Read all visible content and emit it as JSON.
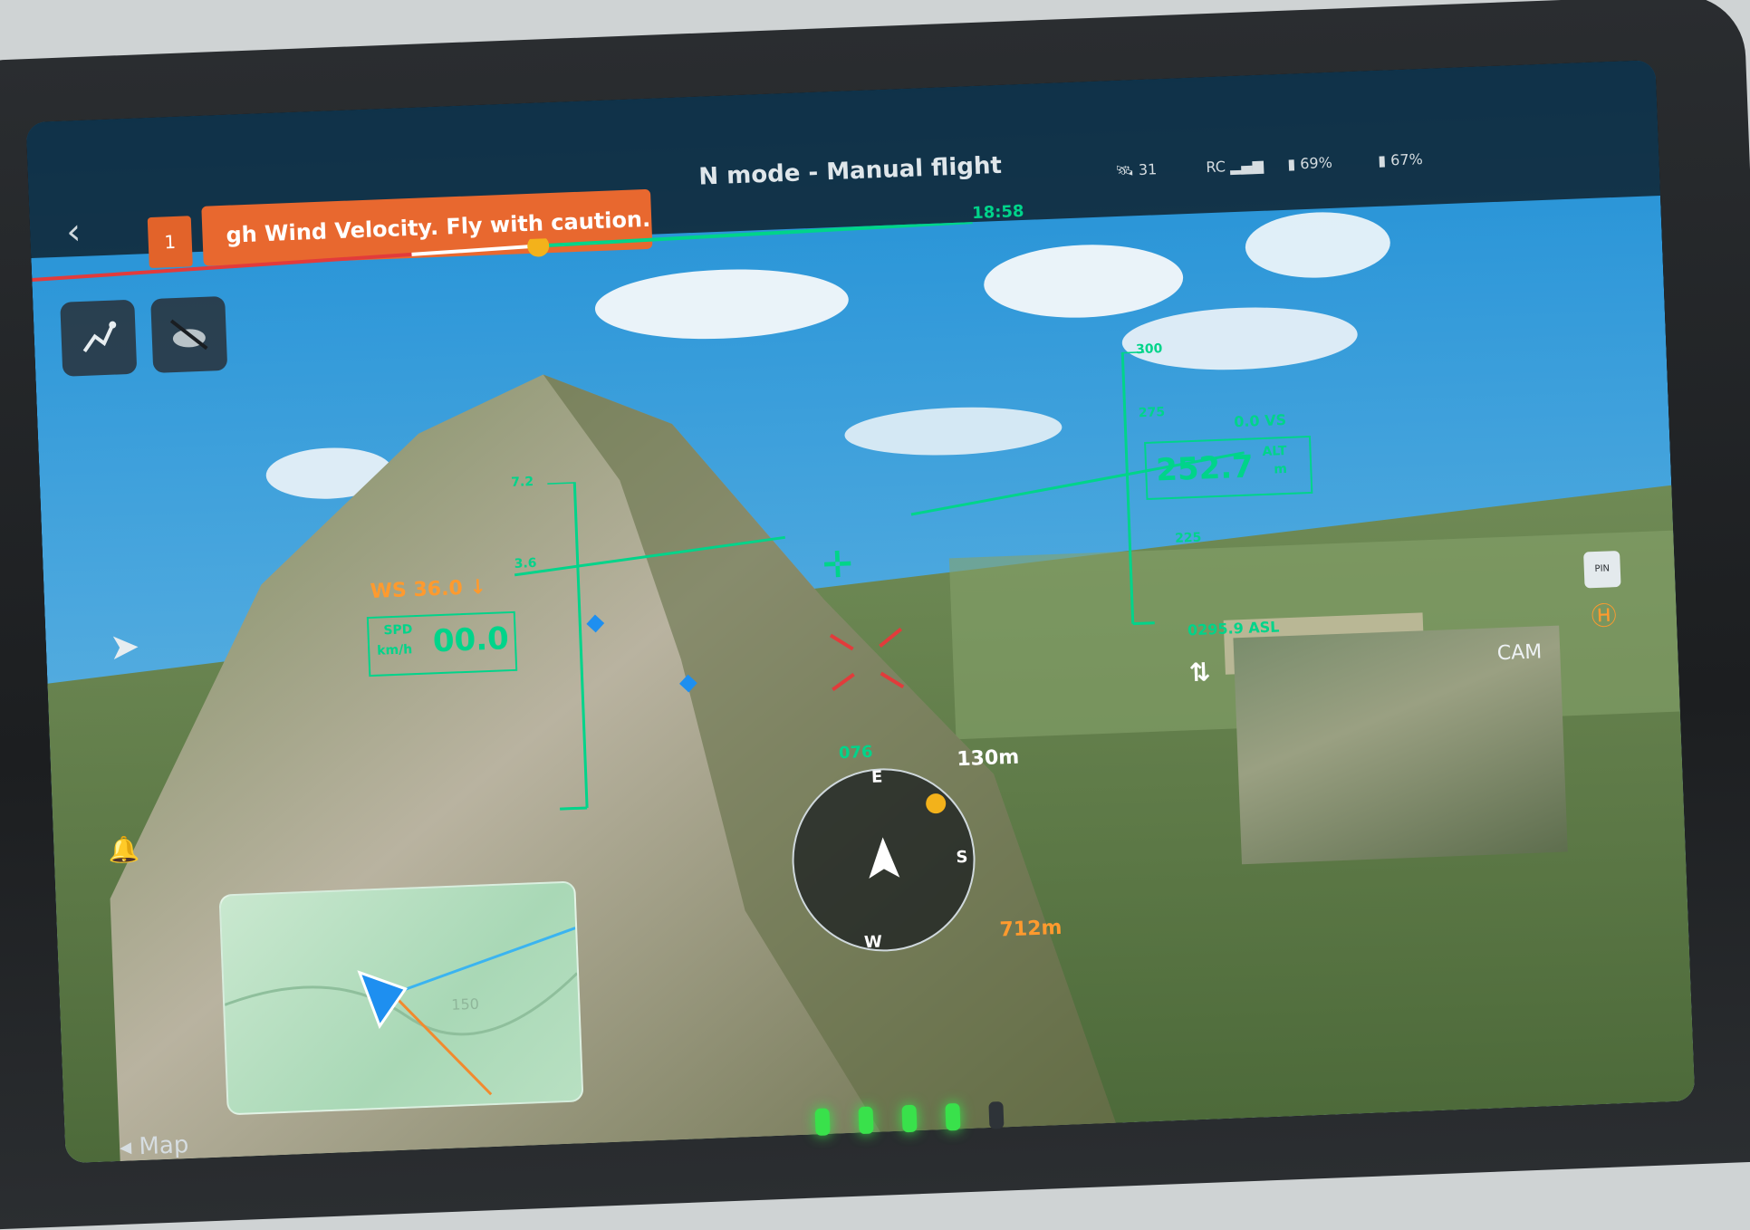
{
  "header": {
    "back_icon": "chevron-left-icon",
    "warning_count": "1",
    "warning_text": "gh Wind Velocity. Fly with caution.",
    "flight_mode": "N mode - Manual flight",
    "time_remaining": "18:58",
    "status": {
      "satellites": "31",
      "rc_signal": "RC",
      "battery_1": "69%",
      "battery_2": "67%"
    }
  },
  "toolbar": {
    "route_icon": "route-icon",
    "weather_icon": "cloud-off-icon"
  },
  "hud": {
    "wind_speed": "WS 36.0",
    "wind_arrow": "↓",
    "speed_label": "SPD",
    "speed_unit": "km/h",
    "speed_value": "00.0",
    "spd_tick_upper": "7.2",
    "spd_tick_lower": "3.6",
    "altitude_value": "252.7",
    "altitude_label": "ALT",
    "altitude_unit": "m",
    "vertical_speed": "0.0 VS",
    "alt_tick_top": "300",
    "alt_tick_mid": "275",
    "alt_tick_low": "225",
    "asl_value": "0295.9 ASL",
    "heading": "076",
    "compass_e": "E",
    "compass_s": "S",
    "compass_w": "W",
    "home_distance": "130m",
    "waypoint_distance": "712m"
  },
  "map": {
    "label": "Map",
    "contour": "150"
  },
  "pip": {
    "label": "CAM"
  },
  "side": {
    "home_icon": "home-point-icon",
    "pin_label": "PIN"
  }
}
